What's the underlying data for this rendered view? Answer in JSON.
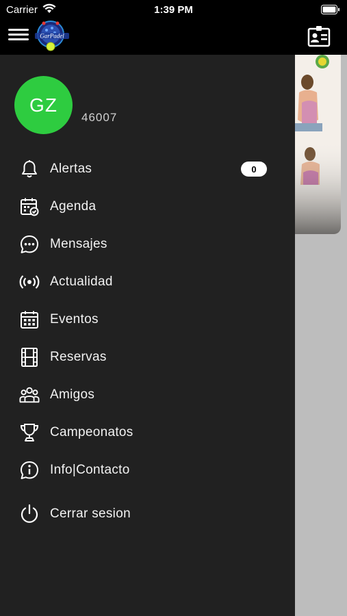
{
  "status_bar": {
    "carrier": "Carrier",
    "time": "1:39 PM"
  },
  "header": {
    "logo_text": "GarPadel"
  },
  "user": {
    "initials": "GZ",
    "code": "46007"
  },
  "menu": [
    {
      "label": "Alertas",
      "icon": "bell-icon",
      "badge": "0"
    },
    {
      "label": "Agenda",
      "icon": "calendar-check-icon"
    },
    {
      "label": "Mensajes",
      "icon": "chat-icon"
    },
    {
      "label": "Actualidad",
      "icon": "broadcast-icon"
    },
    {
      "label": "Eventos",
      "icon": "calendar-grid-icon"
    },
    {
      "label": "Reservas",
      "icon": "film-icon"
    },
    {
      "label": "Amigos",
      "icon": "group-icon"
    },
    {
      "label": "Campeonatos",
      "icon": "trophy-icon"
    },
    {
      "label": "Info|Contacto",
      "icon": "info-icon"
    },
    {
      "label": "Cerrar sesion",
      "icon": "power-icon"
    }
  ],
  "colors": {
    "avatar": "#2ecc40",
    "drawer": "#212121",
    "topbar": "#000000",
    "overlay": "#bdbdbd"
  }
}
